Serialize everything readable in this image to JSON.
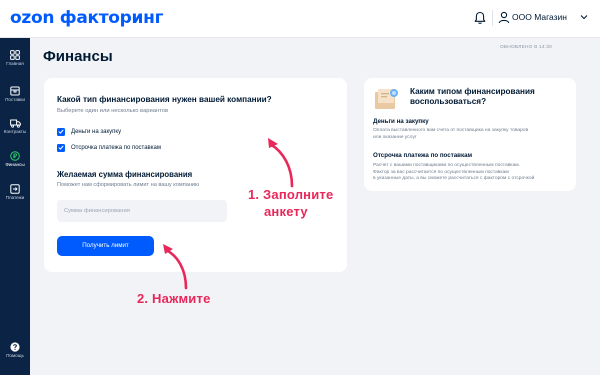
{
  "header": {
    "logo": "ozon факторинг",
    "company": "ООО Магазин"
  },
  "sidebar": {
    "items": [
      {
        "label": "Главная",
        "icon": "grid-icon"
      },
      {
        "label": "Поставки",
        "icon": "box-icon"
      },
      {
        "label": "Контракты",
        "icon": "truck-icon"
      },
      {
        "label": "Финансы",
        "icon": "coin-icon",
        "active": true
      },
      {
        "label": "Платежи",
        "icon": "payment-icon"
      }
    ],
    "help_label": "Помощь"
  },
  "page": {
    "title": "Финансы",
    "updated": "ОБНОВЛЕНО В 14:30"
  },
  "form": {
    "question": "Какой тип финансирования нужен вашей компании?",
    "question_hint": "Выберете один или несколько вариантов",
    "options": [
      {
        "label": "Деньги на закупку",
        "checked": true
      },
      {
        "label": "Отсрочка платежа по поставкам",
        "checked": true
      }
    ],
    "sum_title": "Желаемая сумма финансирования",
    "sum_hint": "Поможет нам сформировать лимит на вашу компанию",
    "sum_placeholder": "Сумма финансирования",
    "sum_value": "",
    "submit_label": "Получить лимит"
  },
  "info": {
    "title": "Каким типом финансирования воспользоваться?",
    "sections": [
      {
        "heading": "Деньги на закупку",
        "text": [
          "Оплата выставленного вам счета от поставщика на закупку товаров",
          "или оказание услуг"
        ]
      },
      {
        "heading": "Отсрочка платежа по поставкам",
        "text": [
          "Расчет с вашими поставщиками по осуществленным поставкам.",
          "Фактор за вас рассчитается по осуществленным поставкам",
          "в указанные даты, а вы сможете рассчитаться с фактором с отсрочкой"
        ]
      }
    ]
  },
  "annotations": {
    "step1_line1": "1. Заполните",
    "step1_line2": "анкету",
    "step2": "2. Нажмите"
  },
  "colors": {
    "brand": "#005bff",
    "sidebar": "#0b2445",
    "accent": "#e8285a",
    "background": "#f2f3f7"
  }
}
